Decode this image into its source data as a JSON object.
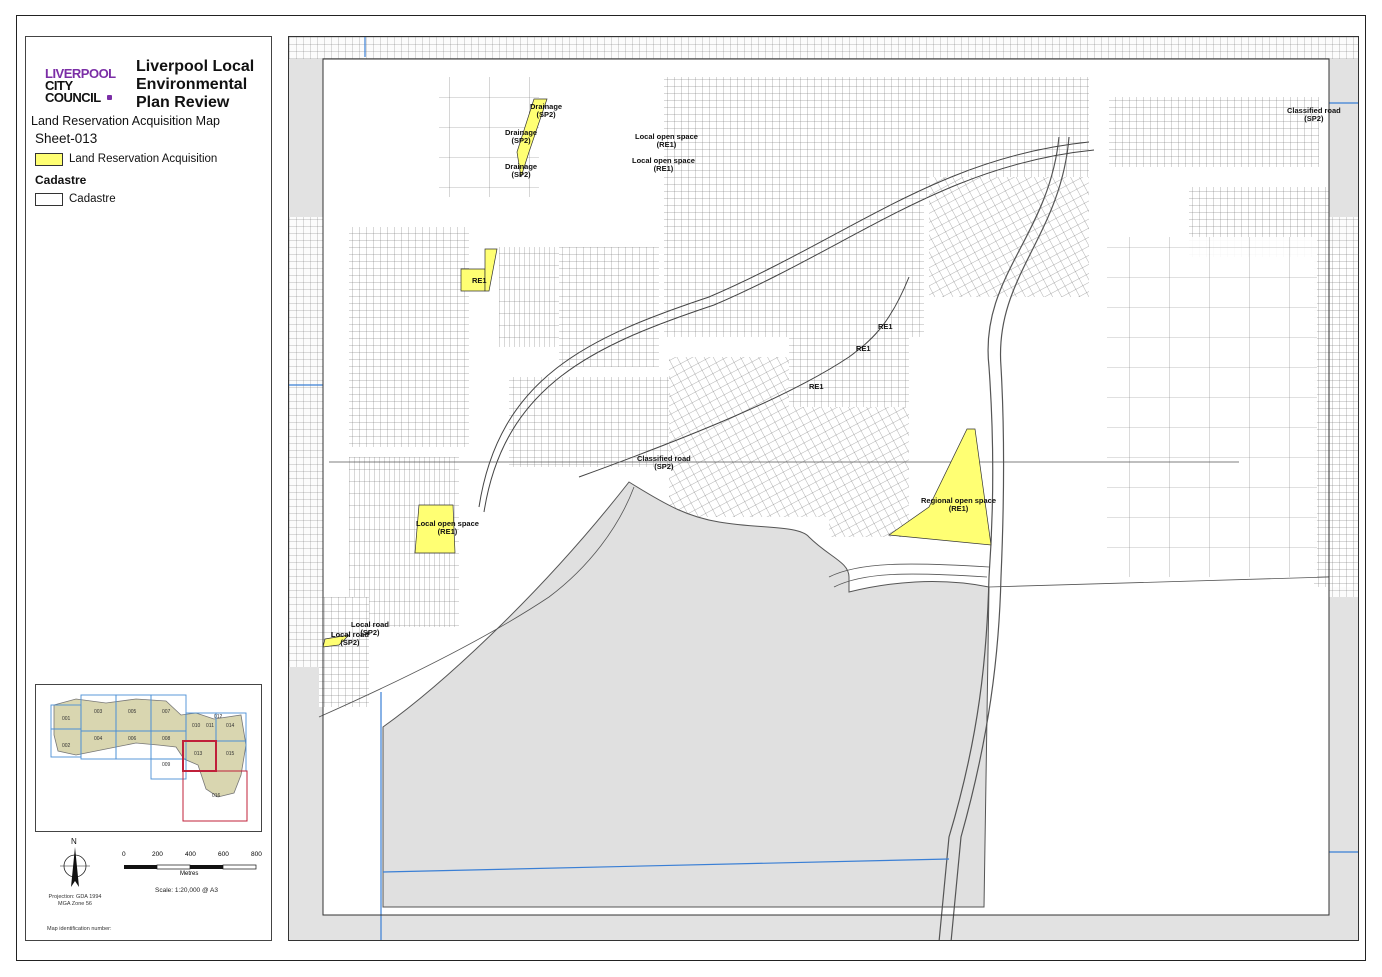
{
  "logo": {
    "line1": "LIVERPOOL",
    "line2": "CITY",
    "line3": "COUNCIL"
  },
  "legend": {
    "plan_title": "Liverpool Local Environmental Plan Review",
    "map_title": "Land Reservation Acquisition Map",
    "sheet": "Sheet-013",
    "items": [
      {
        "label": "Land Reservation Acquisition",
        "color": "#ffff73"
      }
    ],
    "cadastre_heading": "Cadastre",
    "cadastre_label": "Cadastre"
  },
  "index_map": {
    "sheets": [
      "001",
      "002",
      "003",
      "004",
      "005",
      "006",
      "007",
      "008",
      "009",
      "010",
      "011",
      "012",
      "013",
      "014",
      "015",
      "016"
    ],
    "current": "013",
    "highlight_color": "#c0203a",
    "grid_color": "#4a8fd6",
    "fill_color": "#d9d6b0"
  },
  "north": {
    "label": "N"
  },
  "scale": {
    "ticks": [
      "0",
      "200",
      "400",
      "600",
      "800"
    ],
    "unit": "Metres",
    "text": "Scale: 1:20,000 @ A3"
  },
  "projection": {
    "line1": "Projection: GDA 1994",
    "line2": "MGA Zone 56"
  },
  "map_id": "Map identification number:",
  "map_labels": [
    {
      "text": "Drainage (SP2)"
    },
    {
      "text": "Drainage (SP2)"
    },
    {
      "text": "Drainage (SP2)"
    },
    {
      "text": "Local open space (RE1)"
    },
    {
      "text": "Local open space (RE1)"
    },
    {
      "text": "Classified road (SP2)"
    },
    {
      "text": "RE1"
    },
    {
      "text": "RE1"
    },
    {
      "text": "RE1"
    },
    {
      "text": "RE1"
    },
    {
      "text": "Classified road (SP2)"
    },
    {
      "text": "Regional open space (RE1)"
    },
    {
      "text": "Local open space (RE1)"
    },
    {
      "text": "Local road (SP2)"
    },
    {
      "text": "Local road (SP2)"
    }
  ],
  "colors": {
    "acquisition": "#ffff73",
    "water": "#e0e0e0",
    "cadastre_line": "#555555",
    "boundary_blue": "#3a7fd5"
  }
}
